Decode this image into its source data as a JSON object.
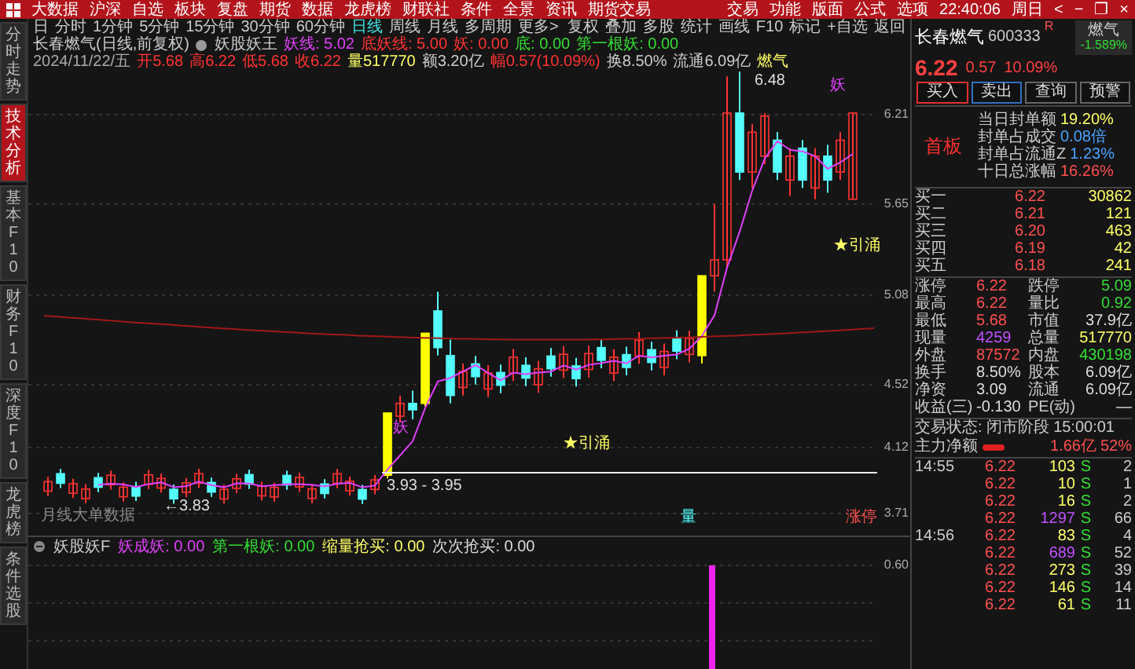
{
  "menu_bar": {
    "items": [
      "大数据",
      "沪深",
      "自选",
      "板块",
      "复盘",
      "期货",
      "数据",
      "龙虎榜",
      "财联社",
      "条件",
      "全景",
      "资讯",
      "期货交易"
    ],
    "right_items": [
      "交易",
      "功能",
      "版面",
      "公式",
      "选项"
    ],
    "clock": "22:40:06",
    "weekday": "周日",
    "window_controls": [
      "<",
      "−",
      "❐",
      "×"
    ]
  },
  "side_tabs": [
    {
      "label": "分时走势",
      "selected": false
    },
    {
      "label": "技术分析",
      "selected": true
    },
    {
      "label": "基本F10",
      "selected": false
    },
    {
      "label": "财务F10",
      "selected": false
    },
    {
      "label": "深度F10",
      "selected": false
    },
    {
      "label": "龙虎榜",
      "selected": false
    },
    {
      "label": "条件选股",
      "selected": false
    }
  ],
  "period_bar": {
    "periods": [
      {
        "label": "日",
        "selected": false
      },
      {
        "label": "分时",
        "selected": false
      },
      {
        "label": "1分钟",
        "selected": false
      },
      {
        "label": "5分钟",
        "selected": false
      },
      {
        "label": "15分钟",
        "selected": false
      },
      {
        "label": "30分钟",
        "selected": false
      },
      {
        "label": "60分钟",
        "selected": false
      },
      {
        "label": "日线",
        "selected": true
      },
      {
        "label": "周线",
        "selected": false
      },
      {
        "label": "月线",
        "selected": false
      },
      {
        "label": "多周期",
        "selected": false
      },
      {
        "label": "更多>",
        "selected": false
      }
    ],
    "tools": [
      "复权",
      "叠加",
      "多股",
      "统计",
      "画线",
      "F10",
      "标记",
      "+自选",
      "返回"
    ]
  },
  "chart": {
    "title": "长春燃气(日线,前复权)",
    "indicator": "妖股妖王",
    "indicator_values": [
      {
        "text": "妖线: 5.02",
        "color": "#e040fb"
      },
      {
        "text": "底妖线: 5.00",
        "color": "#ff3232"
      },
      {
        "text": "妖: 0.00",
        "color": "#ff3232"
      },
      {
        "text": "底: 0.00",
        "color": "#33dd33"
      },
      {
        "text": "第一根妖: 0.00",
        "color": "#33dd33"
      }
    ],
    "ohlc_line": [
      {
        "text": "2024/11/22/五",
        "color": "#aaaaaa"
      },
      {
        "text": "开5.68",
        "color": "#ff3232"
      },
      {
        "text": "高6.22",
        "color": "#ff3232"
      },
      {
        "text": "低5.68",
        "color": "#ff3232"
      },
      {
        "text": "收6.22",
        "color": "#ff3232"
      },
      {
        "text": "量517770",
        "color": "#ffff66"
      },
      {
        "text": "额3.20亿",
        "color": "#cccccc"
      },
      {
        "text": "幅0.57(10.09%)",
        "color": "#ff3232"
      },
      {
        "text": "换8.50%",
        "color": "#cccccc"
      },
      {
        "text": "流通6.09亿",
        "color": "#cccccc"
      },
      {
        "text": "燃气",
        "color": "#ffff66"
      }
    ],
    "annotations": [
      {
        "text": "6.48",
        "color": "#dddddd"
      },
      {
        "text": "妖",
        "color": "#e040fb"
      },
      {
        "text": "★引涌",
        "color": "#ffff66"
      },
      {
        "text": "★引涌",
        "color": "#ffff66"
      },
      {
        "text": "妖",
        "color": "#e040fb"
      },
      {
        "text": "3.93 - 3.95",
        "color": "#dddddd"
      },
      {
        "text": "←3.83",
        "color": "#dddddd"
      },
      {
        "text": "月线大单数据",
        "color": "#888888"
      },
      {
        "text": "量",
        "color": "#54fcfc"
      },
      {
        "text": "涨停",
        "color": "#ff5050"
      }
    ],
    "price_ticks": [
      "6.21",
      "5.65",
      "5.08",
      "4.52",
      "4.12",
      "3.71"
    ]
  },
  "sub_chart": {
    "indicator": "妖股妖F",
    "values": [
      {
        "text": "妖成妖: 0.00",
        "color": "#e040fb"
      },
      {
        "text": "第一根妖: 0.00",
        "color": "#33dd33"
      },
      {
        "text": "缩量抢买: 0.00",
        "color": "#ffff66"
      },
      {
        "text": "次次抢买: 0.00",
        "color": "#dddddd"
      }
    ],
    "tick": "0.60"
  },
  "quote": {
    "name": "长春燃气",
    "code": "600333",
    "mark": "R",
    "sector": "燃气",
    "sector_change": "-1.589%",
    "price": "6.22",
    "change": "0.57",
    "change_pct": "10.09%",
    "buttons": [
      {
        "label": "买入",
        "color": "#e03030"
      },
      {
        "label": "卖出",
        "color": "#3070c0"
      },
      {
        "label": "查询",
        "color": "#666666"
      },
      {
        "label": "预警",
        "color": "#666666"
      }
    ],
    "board": "首板",
    "board_stats": [
      {
        "label": "当日封单额",
        "value": "19.20%",
        "color": "#ffff66"
      },
      {
        "label": "封单占成交",
        "value": "0.08倍",
        "color": "#4aa3ff"
      },
      {
        "label": "封单占流通Z",
        "value": "1.23%",
        "color": "#4aa3ff"
      },
      {
        "label": "十日总涨幅",
        "value": "16.26%",
        "color": "#ff5050"
      }
    ],
    "order_book": [
      {
        "label": "买一",
        "price": "6.22",
        "volume": "30862"
      },
      {
        "label": "买二",
        "price": "6.21",
        "volume": "121"
      },
      {
        "label": "买三",
        "price": "6.20",
        "volume": "463"
      },
      {
        "label": "买四",
        "price": "6.19",
        "volume": "42"
      },
      {
        "label": "买五",
        "price": "6.18",
        "volume": "241"
      }
    ],
    "stats": [
      {
        "label": "涨停",
        "value": "6.22",
        "color": "#ff5050"
      },
      {
        "label": "跌停",
        "value": "5.09",
        "color": "#33dd33"
      },
      {
        "label": "最高",
        "value": "6.22",
        "color": "#ff5050"
      },
      {
        "label": "量比",
        "value": "0.92",
        "color": "#33dd33"
      },
      {
        "label": "最低",
        "value": "5.68",
        "color": "#ff5050"
      },
      {
        "label": "市值",
        "value": "37.9亿"
      },
      {
        "label": "现量",
        "value": "4259",
        "color": "#c050ff"
      },
      {
        "label": "总量",
        "value": "517770",
        "color": "#ffff66"
      },
      {
        "label": "外盘",
        "value": "87572",
        "color": "#ff5050"
      },
      {
        "label": "内盘",
        "value": "430198",
        "color": "#33dd33"
      },
      {
        "label": "换手",
        "value": "8.50%"
      },
      {
        "label": "股本",
        "value": "6.09亿"
      },
      {
        "label": "净资",
        "value": "3.09"
      },
      {
        "label": "流通",
        "value": "6.09亿"
      },
      {
        "label": "收益(三)",
        "value": "-0.130"
      },
      {
        "label": "PE(动)",
        "value": "—"
      }
    ],
    "trade_status": "交易状态: 闭市阶段",
    "status_time": "15:00:01",
    "main_flow_label": "主力净额",
    "main_flow": "1.66亿",
    "main_flow_pct": "52%",
    "ticks": [
      {
        "time": "14:55",
        "price": "6.22",
        "volume": "103",
        "side": "S",
        "count": "2",
        "color": "#ffff66"
      },
      {
        "price": "6.22",
        "volume": "10",
        "side": "S",
        "count": "1",
        "color": "#ffff66"
      },
      {
        "price": "6.22",
        "volume": "16",
        "side": "S",
        "count": "2",
        "color": "#ffff66"
      },
      {
        "price": "6.22",
        "volume": "1297",
        "side": "S",
        "count": "66",
        "color": "#c050ff"
      },
      {
        "time": "14:56",
        "price": "6.22",
        "volume": "83",
        "side": "S",
        "count": "4",
        "color": "#ffff66"
      },
      {
        "price": "6.22",
        "volume": "689",
        "side": "S",
        "count": "52",
        "color": "#c050ff"
      },
      {
        "price": "6.22",
        "volume": "273",
        "side": "S",
        "count": "39",
        "color": "#ffff66"
      },
      {
        "price": "6.22",
        "volume": "146",
        "side": "S",
        "count": "14",
        "color": "#ffff66"
      },
      {
        "price": "6.22",
        "volume": "61",
        "side": "S",
        "count": "11",
        "color": "#ffff66"
      }
    ]
  }
}
